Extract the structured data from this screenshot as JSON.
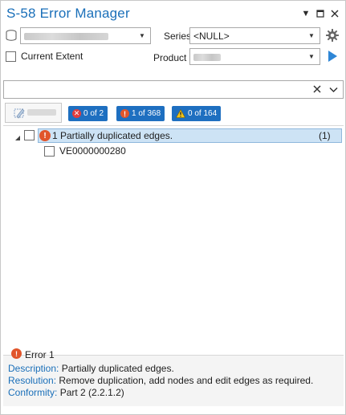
{
  "window": {
    "title": "S-58 Error Manager",
    "title_color": "#1a6fb9"
  },
  "toolbar": {
    "series_label": "Series",
    "series_value": "<NULL>",
    "current_extent_label": "Current Extent",
    "product_label": "Product"
  },
  "filters": {
    "errors_badge": "0 of 2",
    "warnings_badge": "1 of 368",
    "caution_badge": "0 of 164",
    "badge_color": "#1e6fc0"
  },
  "tree": {
    "group_label": "1 Partially duplicated edges.",
    "group_count": "(1)",
    "child_label": "VE0000000280"
  },
  "details": {
    "heading": "Error 1",
    "description_label": "Description:",
    "description_value": "Partially duplicated edges.",
    "resolution_label": "Resolution:",
    "resolution_value": "Remove duplication, add nodes and edit edges as required.",
    "conformity_label": "Conformity:",
    "conformity_value": "Part 2 (2.2.1.2)"
  }
}
